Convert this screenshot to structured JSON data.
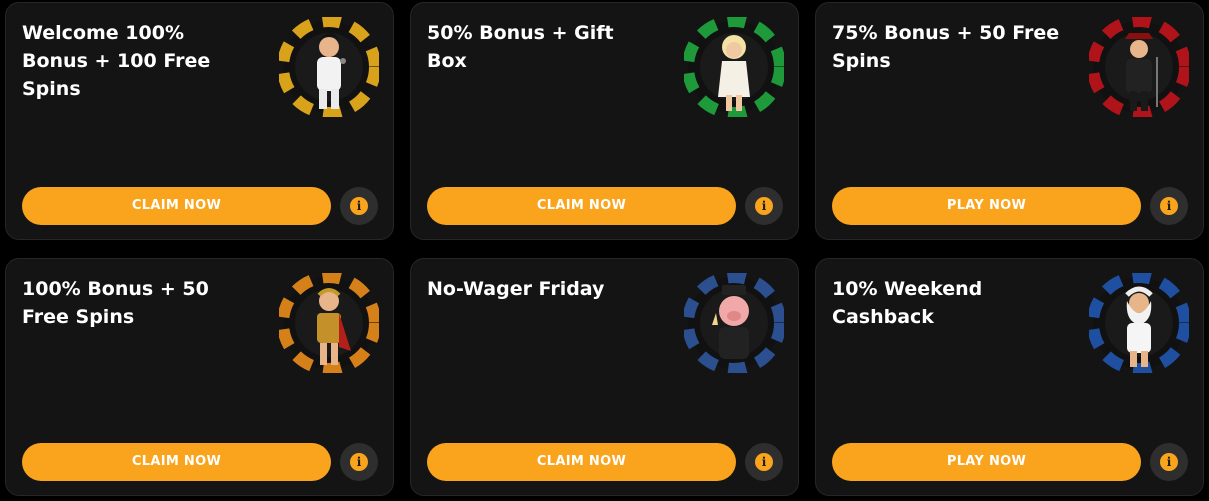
{
  "promotions": [
    {
      "title": "Welcome 100% Bonus + 100 Free Spins",
      "button_label": "CLAIM NOW",
      "info_glyph": "i",
      "character_icon": "elvis-character-icon",
      "ring_color": "#d9a21b",
      "ring_alt_color": "#111111"
    },
    {
      "title": "50% Bonus + Gift Box",
      "button_label": "CLAIM NOW",
      "info_glyph": "i",
      "character_icon": "marilyn-character-icon",
      "ring_color": "#1e9a3a",
      "ring_alt_color": "#111111"
    },
    {
      "title": "75% Bonus + 50 Free Spins",
      "button_label": "PLAY NOW",
      "info_glyph": "i",
      "character_icon": "crooner-character-icon",
      "ring_color": "#b0141a",
      "ring_alt_color": "#111111"
    },
    {
      "title": "100% Bonus + 50 Free Spins",
      "button_label": "CLAIM NOW",
      "info_glyph": "i",
      "character_icon": "roman-character-icon",
      "ring_color": "#d6801a",
      "ring_alt_color": "#111111"
    },
    {
      "title": "No-Wager Friday",
      "button_label": "CLAIM NOW",
      "info_glyph": "i",
      "character_icon": "pig-character-icon",
      "ring_color": "#2b4f8f",
      "ring_alt_color": "#111111"
    },
    {
      "title": "10% Weekend Cashback",
      "button_label": "PLAY NOW",
      "info_glyph": "i",
      "character_icon": "zeus-character-icon",
      "ring_color": "#1f4fa0",
      "ring_alt_color": "#111111"
    }
  ],
  "colors": {
    "accent": "#f9a41c",
    "card_background": "#141414",
    "page_background": "#000000"
  }
}
